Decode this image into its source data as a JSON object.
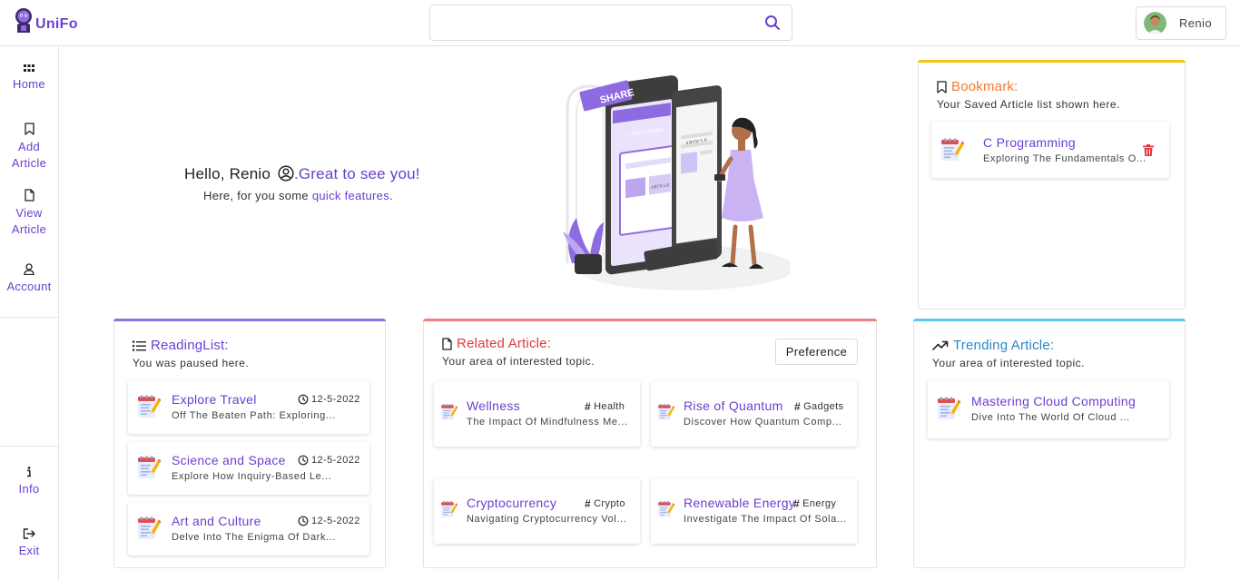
{
  "app": {
    "name": "UniFo"
  },
  "search": {
    "placeholder": "",
    "value": ""
  },
  "user": {
    "name": "Renio"
  },
  "sidebar": {
    "items": [
      {
        "label": "Home",
        "icon": "grid-icon"
      },
      {
        "label": "Add\nArticle",
        "icon": "bookmark-icon"
      },
      {
        "label": "View\nArticle",
        "icon": "file-icon"
      },
      {
        "label": "Account",
        "icon": "user-icon"
      }
    ],
    "bottom": [
      {
        "label": "Info",
        "icon": "info-icon"
      },
      {
        "label": "Exit",
        "icon": "exit-icon"
      }
    ]
  },
  "greeting": {
    "hello": "Hello, Renio",
    "accent": ".Great to see you!",
    "sub_prefix": "Here, for you some",
    "sub_accent": "quick features",
    "sub_suffix": "."
  },
  "illustration": {
    "share_label": "SHARE",
    "more_articles": "+ More Articles",
    "article_label": "ARTICLE"
  },
  "bookmark": {
    "title": "Bookmark:",
    "subtitle": "Your Saved Article list shown here.",
    "items": [
      {
        "title": "C Programming",
        "desc": "Exploring The Fundamentals O..."
      }
    ]
  },
  "reading_list": {
    "title": "ReadingList:",
    "subtitle": "You was paused here.",
    "items": [
      {
        "title": "Explore Travel",
        "date": "12-5-2022",
        "desc": "Off The Beaten Path: Exploring..."
      },
      {
        "title": "Science and Space",
        "date": "12-5-2022",
        "desc": "Explore How Inquiry-Based Le..."
      },
      {
        "title": "Art and Culture",
        "date": "12-5-2022",
        "desc": "Delve Into The Enigma Of Dark..."
      }
    ]
  },
  "related": {
    "title": "Related Article:",
    "subtitle": "Your area of interested topic.",
    "preference_label": "Preference",
    "items": [
      {
        "title": "Wellness",
        "tag": "Health",
        "desc": "The Impact Of Mindfulness Me..."
      },
      {
        "title": "Rise of Quantum",
        "tag": "Gadgets",
        "desc": "Discover How Quantum Comp..."
      },
      {
        "title": "Cryptocurrency",
        "tag": "Crypto",
        "desc": "Navigating Cryptocurrency Vol..."
      },
      {
        "title": "Renewable Energy",
        "tag": "Energy",
        "desc": "Investigate The Impact Of Sola..."
      }
    ]
  },
  "trending": {
    "title": "Trending Article:",
    "subtitle": "Your area of interested topic.",
    "items": [
      {
        "title": "Mastering Cloud Computing",
        "desc": "Dive Into The World Of Cloud ..."
      }
    ]
  },
  "colors": {
    "accent": "#6a3fd1",
    "bookmark": "#f27b2b",
    "bookmark_bar": "#f5c518",
    "reading_bar": "#8a72e6",
    "related": "#e03a3a",
    "related_bar": "#f08080",
    "trending": "#2a86c8",
    "trending_bar": "#5bc8f0",
    "delete": "#e03a3a"
  }
}
